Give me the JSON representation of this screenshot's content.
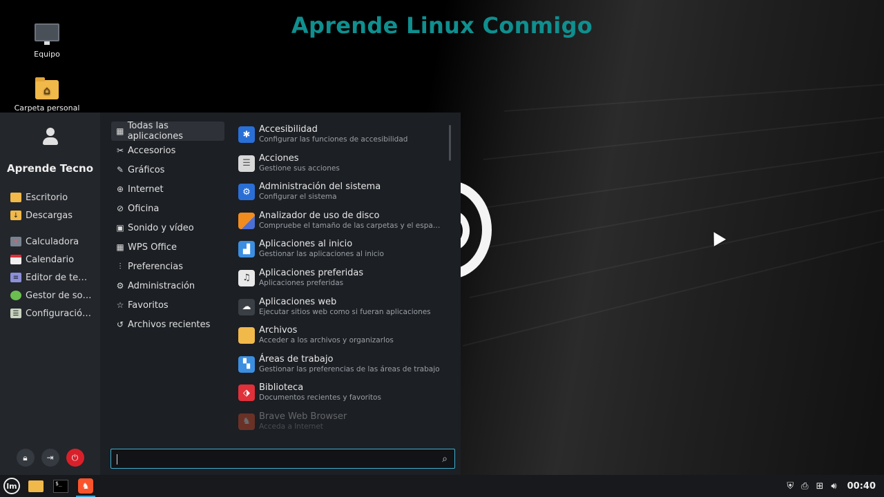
{
  "overlay": {
    "title": "Aprende Linux Conmigo"
  },
  "desktop": {
    "icons": [
      {
        "label": "Equipo",
        "icon": "computer-icon"
      },
      {
        "label": "Carpeta personal",
        "icon": "home-folder-icon"
      }
    ]
  },
  "menu": {
    "username": "Aprende Tecno",
    "places": [
      {
        "label": "Escritorio",
        "icon": "folder-icon",
        "color": "#f1b84a"
      },
      {
        "label": "Descargas",
        "icon": "download-folder-icon",
        "color": "#f1b84a"
      }
    ],
    "favorites": [
      {
        "label": "Calculadora",
        "icon": "calculator-icon",
        "color": "#7a8290"
      },
      {
        "label": "Calendario",
        "icon": "calendar-icon",
        "color": "#f0f0f0"
      },
      {
        "label": "Editor de te…",
        "icon": "text-editor-icon",
        "color": "#8c8fd9"
      },
      {
        "label": "Gestor de so…",
        "icon": "software-manager-icon",
        "color": "#6bbf4e"
      },
      {
        "label": "Configuració…",
        "icon": "settings-icon",
        "color": "#c8d4c0"
      }
    ],
    "categories": [
      {
        "label": "Todas las aplicaciones",
        "icon": "grid-icon",
        "selected": true
      },
      {
        "label": "Accesorios",
        "icon": "tools-icon"
      },
      {
        "label": "Gráficos",
        "icon": "graphics-icon"
      },
      {
        "label": "Internet",
        "icon": "globe-icon"
      },
      {
        "label": "Oficina",
        "icon": "paperclip-icon"
      },
      {
        "label": "Sonido y vídeo",
        "icon": "media-icon"
      },
      {
        "label": "WPS Office",
        "icon": "grid-icon"
      },
      {
        "label": "Preferencias",
        "icon": "sliders-icon"
      },
      {
        "label": "Administración",
        "icon": "gear-icon"
      },
      {
        "label": "Favoritos",
        "icon": "star-icon"
      },
      {
        "label": "Archivos recientes",
        "icon": "history-icon"
      }
    ],
    "apps": [
      {
        "name": "Accesibilidad",
        "desc": "Configurar las funciones de accesibilidad",
        "icon": "accessibility-icon",
        "color": "#2a6fd6"
      },
      {
        "name": "Acciones",
        "desc": "Gestione sus acciones",
        "icon": "actions-icon",
        "color": "#d8d8d8"
      },
      {
        "name": "Administración del sistema",
        "desc": "Configurar el sistema",
        "icon": "system-admin-icon",
        "color": "#2a6fd6"
      },
      {
        "name": "Analizador de uso de disco",
        "desc": "Compruebe el tamaño de las carpetas y el espacio…",
        "icon": "disk-usage-icon",
        "color": "#f28c1e"
      },
      {
        "name": "Aplicaciones al inicio",
        "desc": "Gestionar las aplicaciones al inicio",
        "icon": "startup-apps-icon",
        "color": "#3c8ee0"
      },
      {
        "name": "Aplicaciones preferidas",
        "desc": "Aplicaciones preferidas",
        "icon": "preferred-apps-icon",
        "color": "#e8e8e8"
      },
      {
        "name": "Aplicaciones web",
        "desc": "Ejecutar sitios web como si fueran aplicaciones",
        "icon": "web-apps-icon",
        "color": "#3a3f46"
      },
      {
        "name": "Archivos",
        "desc": "Acceder a los archivos y organizarlos",
        "icon": "files-icon",
        "color": "#f1b84a"
      },
      {
        "name": "Áreas de trabajo",
        "desc": "Gestionar las preferencias de las áreas de trabajo",
        "icon": "workspaces-icon",
        "color": "#3c8ee0"
      },
      {
        "name": "Biblioteca",
        "desc": "Documentos recientes y favoritos",
        "icon": "library-icon",
        "color": "#e0303a"
      },
      {
        "name": "Brave Web Browser",
        "desc": "Acceda a Internet",
        "icon": "brave-icon",
        "color": "#fb542b"
      }
    ],
    "search": {
      "value": "",
      "placeholder": ""
    }
  },
  "taskbar": {
    "apps": [
      {
        "icon": "files-icon"
      },
      {
        "icon": "terminal-icon",
        "glyph": "$_"
      },
      {
        "icon": "brave-icon",
        "active": true
      }
    ],
    "clock": "00:40"
  }
}
